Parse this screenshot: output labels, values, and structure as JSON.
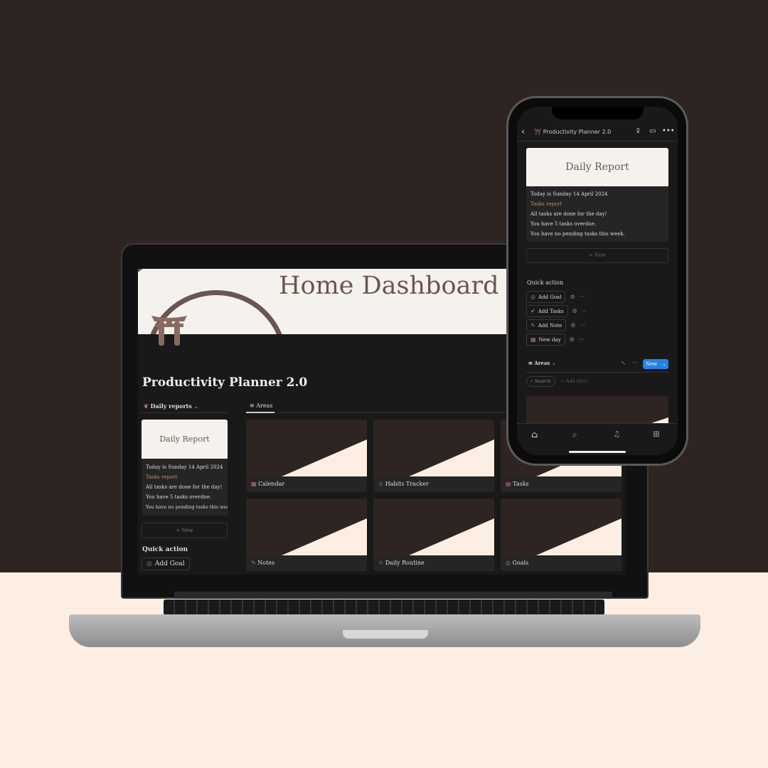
{
  "laptop": {
    "banner_title": "Home Dashboard",
    "page_title": "Productivity Planner 2.0",
    "daily_reports_label": "Daily reports",
    "report_card": {
      "cover_title": "Daily Report",
      "lines": [
        "Today is Sunday 14 April 2024",
        "Tasks report",
        "All tasks are done for the day!",
        "You have 5 tasks overdue.",
        "You have no pending tasks this week."
      ]
    },
    "new_label": "+ New",
    "quick_action_title": "Quick action",
    "quick_actions": [
      "Add Goal"
    ],
    "areas_tab": "Areas",
    "areas": [
      {
        "label": "Calendar",
        "icon": "calendar-icon"
      },
      {
        "label": "Habits Tracker",
        "icon": "trophy-icon"
      },
      {
        "label": "Tasks",
        "icon": "tasks-icon"
      },
      {
        "label": "Notes",
        "icon": "pencil-icon"
      },
      {
        "label": "Daily Routine",
        "icon": "sun-icon"
      },
      {
        "label": "Goals",
        "icon": "target-icon"
      }
    ]
  },
  "phone": {
    "header_title": "Productivity Planner 2.0",
    "report_card": {
      "cover_title": "Daily Report",
      "lines": [
        "Today is Sunday 14 April 2024",
        "Tasks report",
        "All tasks are done for the day!",
        "You have 5 tasks overdue.",
        "You have no pending tasks this week."
      ]
    },
    "new_label": "+ New",
    "quick_action_title": "Quick action",
    "quick_actions": [
      {
        "label": "Add Goal",
        "icon": "target-icon"
      },
      {
        "label": "Add Tasks",
        "icon": "check-circle-icon"
      },
      {
        "label": "Add Note",
        "icon": "pencil-icon"
      },
      {
        "label": "New day",
        "icon": "calendar-icon"
      }
    ],
    "areas_label": "Areas",
    "new_button": "New",
    "search_label": "Search",
    "add_filter_label": "+ Add filter"
  },
  "colors": {
    "wall": "#2e2523",
    "floor": "#fdeee3",
    "accent": "#b47a63",
    "primary_button": "#2383e2",
    "banner": "#f5f2ee"
  }
}
